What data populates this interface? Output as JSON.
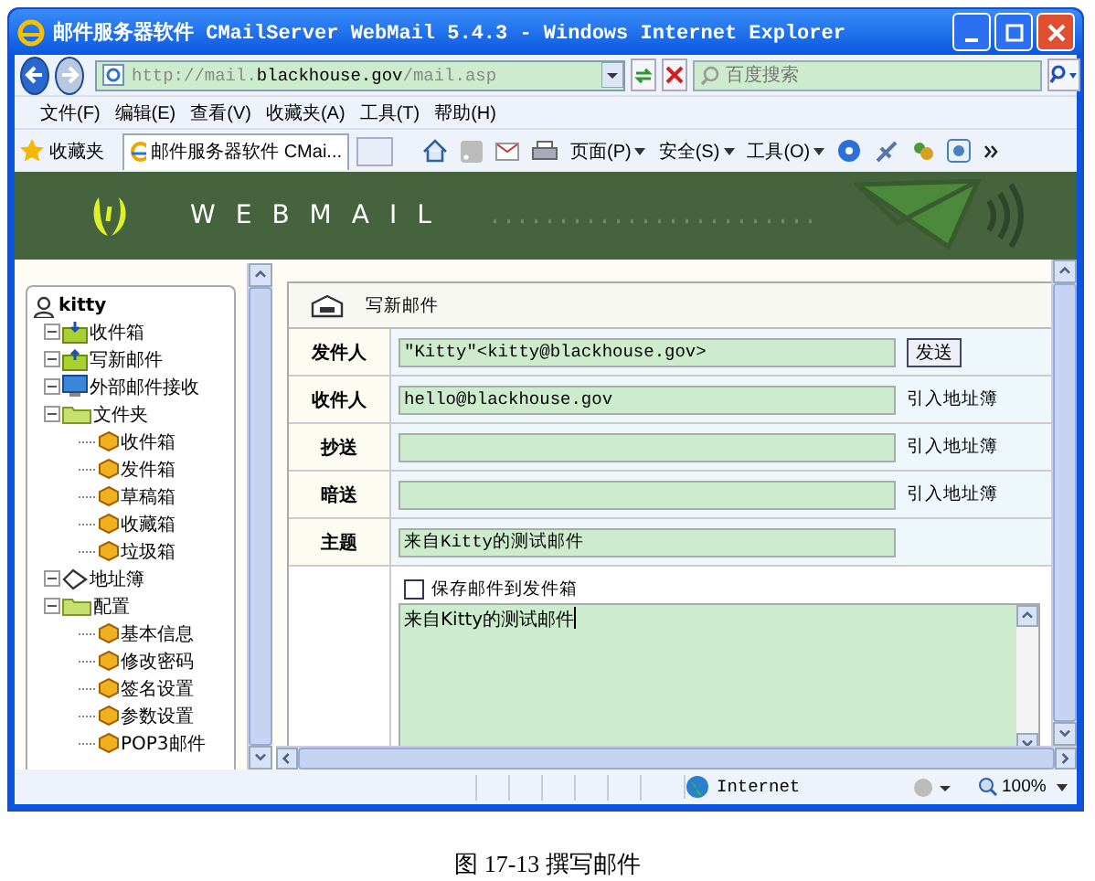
{
  "window": {
    "title": "邮件服务器软件 CMailServer WebMail 5.4.3 - Windows Internet Explorer"
  },
  "address_bar": {
    "url_prefix": "http://mail.",
    "url_host": "blackhouse.gov",
    "url_suffix": "/mail.asp"
  },
  "search": {
    "placeholder": "百度搜索"
  },
  "menu": [
    "文件(F)",
    "编辑(E)",
    "查看(V)",
    "收藏夹(A)",
    "工具(T)",
    "帮助(H)"
  ],
  "favorites": {
    "label": "收藏夹",
    "tab": "邮件服务器软件 CMai..."
  },
  "command_bar": [
    "页面(P)",
    "安全(S)",
    "工具(O)"
  ],
  "banner": {
    "logo": "WEBMAIL"
  },
  "tree": {
    "label": "kitty",
    "children": [
      {
        "label": "收件箱",
        "kind": "inbox",
        "expanded": true
      },
      {
        "label": "写新邮件",
        "kind": "compose",
        "expanded": true
      },
      {
        "label": "外部邮件接收",
        "kind": "external",
        "expanded": true
      },
      {
        "label": "文件夹",
        "kind": "folder",
        "expanded": true,
        "children": [
          {
            "label": "收件箱",
            "kind": "leaf"
          },
          {
            "label": "发件箱",
            "kind": "leaf"
          },
          {
            "label": "草稿箱",
            "kind": "leaf"
          },
          {
            "label": "收藏箱",
            "kind": "leaf"
          },
          {
            "label": "垃圾箱",
            "kind": "leaf"
          }
        ]
      },
      {
        "label": "地址簿",
        "kind": "addressbook",
        "expanded": true
      },
      {
        "label": "配置",
        "kind": "folder",
        "expanded": true,
        "children": [
          {
            "label": "基本信息",
            "kind": "leaf"
          },
          {
            "label": "修改密码",
            "kind": "leaf"
          },
          {
            "label": "签名设置",
            "kind": "leaf"
          },
          {
            "label": "参数设置",
            "kind": "leaf"
          },
          {
            "label": "POP3邮件",
            "kind": "leaf"
          }
        ]
      }
    ]
  },
  "compose": {
    "title": "写新邮件",
    "rows": [
      {
        "label": "发件人",
        "value": "\"Kitty\"<kitty@blackhouse.gov>",
        "action": "发送",
        "kind": "button"
      },
      {
        "label": "收件人",
        "value": "hello@blackhouse.gov",
        "action": "引入地址簿",
        "kind": "link"
      },
      {
        "label": "抄送",
        "action": "引入地址簿",
        "kind": "link"
      },
      {
        "label": "暗送",
        "action": "引入地址簿",
        "kind": "link"
      },
      {
        "label": "主题",
        "value": "来自Kitty的测试邮件"
      }
    ],
    "save_to_sent": {
      "label": "保存邮件到发件箱",
      "checked": false
    },
    "body": "来自Kitty的测试邮件"
  },
  "status_bar": {
    "zone": "Internet",
    "zoom": "100%"
  },
  "caption": "图 17-13  撰写邮件"
}
